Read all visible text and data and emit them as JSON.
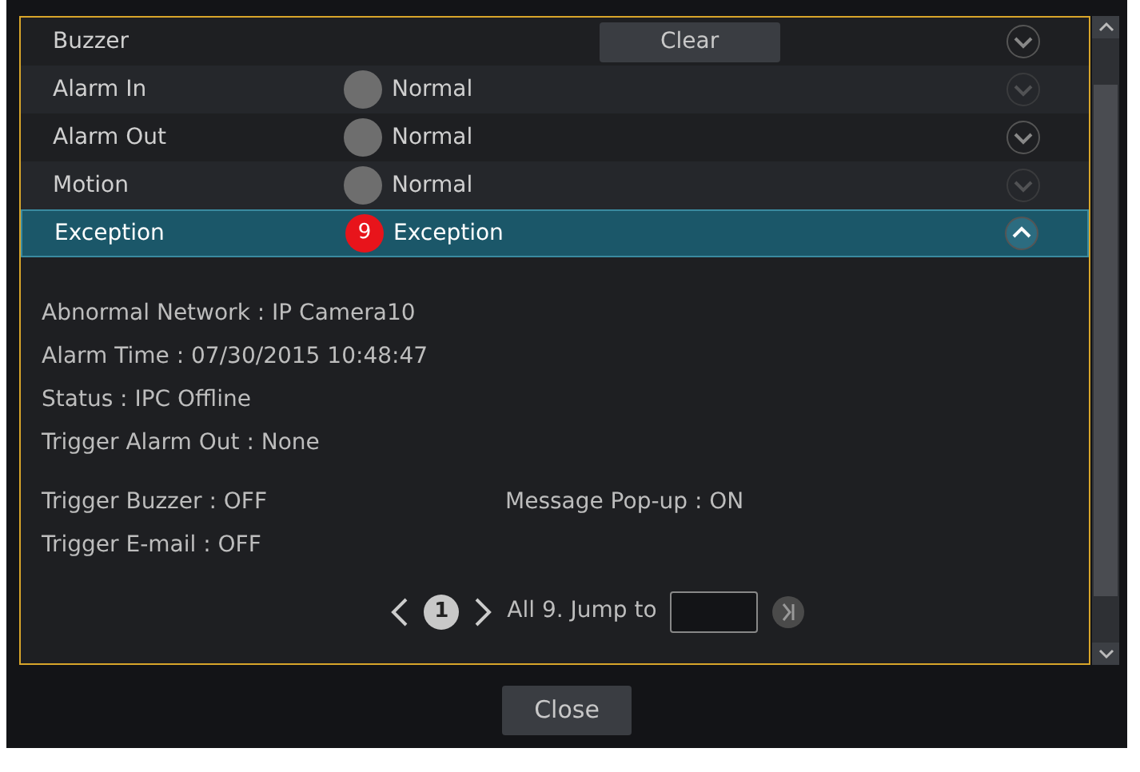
{
  "rows": [
    {
      "kind": "buzzer",
      "label": "Buzzer",
      "button": "Clear",
      "expanded": false,
      "selected": false
    },
    {
      "kind": "status",
      "label": "Alarm In",
      "color": "#6e6e6e",
      "status": "Normal",
      "expanded": false,
      "selected": false
    },
    {
      "kind": "status",
      "label": "Alarm Out",
      "color": "#6e6e6e",
      "status": "Normal",
      "expanded": false,
      "selected": false
    },
    {
      "kind": "status",
      "label": "Motion",
      "color": "#6e6e6e",
      "status": "Normal",
      "expanded": false,
      "selected": false
    },
    {
      "kind": "status",
      "label": "Exception",
      "color": "#e8141b",
      "count": "9",
      "status": "Exception",
      "expanded": true,
      "selected": true
    }
  ],
  "details": [
    "Abnormal Network : IP Camera10",
    "Alarm Time : 07/30/2015 10:48:47",
    "Status : IPC Offline",
    "Trigger Alarm Out : None"
  ],
  "triggers": [
    [
      "Trigger Buzzer : OFF",
      "Message Pop-up : ON"
    ],
    [
      "Trigger E-mail : OFF"
    ]
  ],
  "pager": {
    "page": "1",
    "total": "All 9. Jump to"
  },
  "close_button": "Close"
}
